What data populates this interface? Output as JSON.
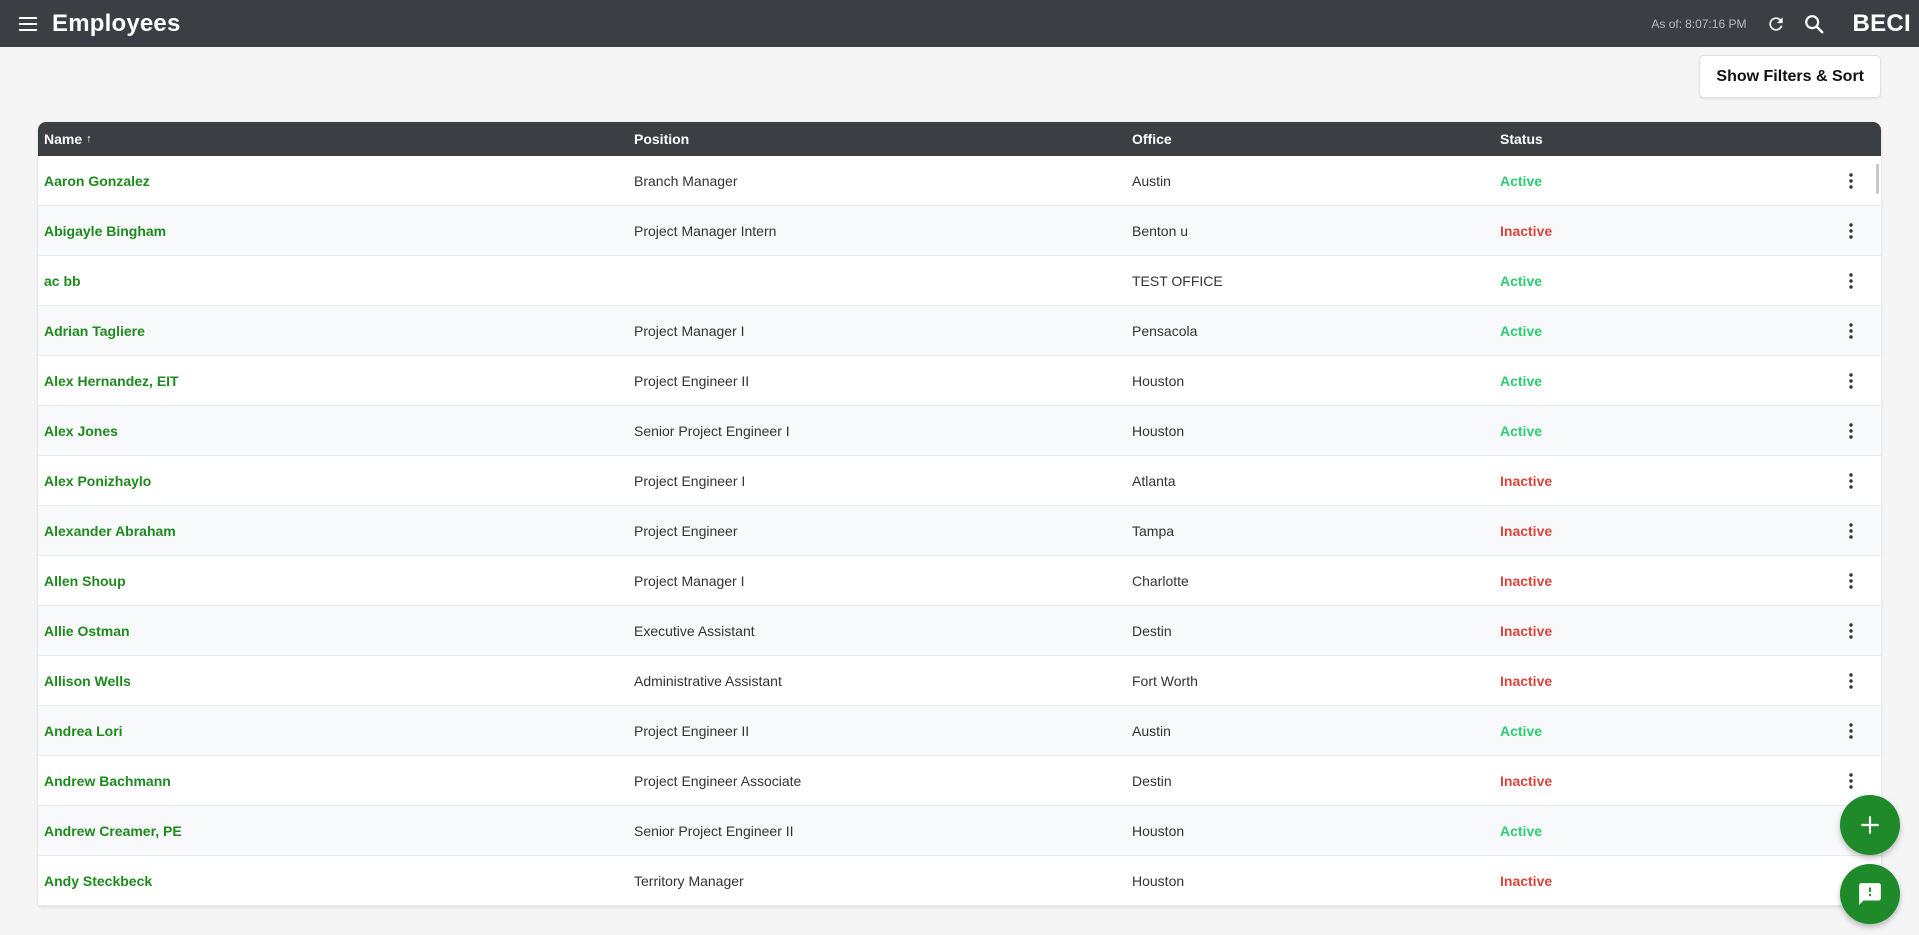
{
  "header": {
    "title": "Employees",
    "as_of_label": "As of:",
    "as_of_time": "8:07:16 PM",
    "brand": "BECI"
  },
  "toolbar": {
    "filter_label": "Show Filters & Sort"
  },
  "table": {
    "columns": {
      "name": "Name",
      "name_sort": "↑",
      "position": "Position",
      "office": "Office",
      "status": "Status"
    },
    "rows": [
      {
        "name": "Aaron Gonzalez",
        "position": "Branch Manager",
        "office": "Austin",
        "status": "Active"
      },
      {
        "name": "Abigayle Bingham",
        "position": "Project Manager Intern",
        "office": "Benton u",
        "status": "Inactive"
      },
      {
        "name": "ac bb",
        "position": "",
        "office": "TEST OFFICE",
        "status": "Active"
      },
      {
        "name": "Adrian Tagliere",
        "position": "Project Manager I",
        "office": "Pensacola",
        "status": "Active"
      },
      {
        "name": "Alex Hernandez, EIT",
        "position": "Project Engineer II",
        "office": "Houston",
        "status": "Active"
      },
      {
        "name": "Alex Jones",
        "position": "Senior Project Engineer I",
        "office": "Houston",
        "status": "Active"
      },
      {
        "name": "Alex Ponizhaylo",
        "position": "Project Engineer I",
        "office": "Atlanta",
        "status": "Inactive"
      },
      {
        "name": "Alexander Abraham",
        "position": "Project Engineer",
        "office": "Tampa",
        "status": "Inactive"
      },
      {
        "name": "Allen Shoup",
        "position": "Project Manager I",
        "office": "Charlotte",
        "status": "Inactive"
      },
      {
        "name": "Allie Ostman",
        "position": "Executive Assistant",
        "office": "Destin",
        "status": "Inactive"
      },
      {
        "name": "Allison Wells",
        "position": "Administrative Assistant",
        "office": "Fort Worth",
        "status": "Inactive"
      },
      {
        "name": "Andrea Lori",
        "position": "Project Engineer II",
        "office": "Austin",
        "status": "Active"
      },
      {
        "name": "Andrew Bachmann",
        "position": "Project Engineer Associate",
        "office": "Destin",
        "status": "Inactive"
      },
      {
        "name": "Andrew Creamer, PE",
        "position": "Senior Project Engineer II",
        "office": "Houston",
        "status": "Active"
      },
      {
        "name": "Andy Steckbeck",
        "position": "Territory Manager",
        "office": "Houston",
        "status": "Inactive"
      }
    ]
  },
  "icons": {
    "menu": "hamburger-menu-icon",
    "refresh": "refresh-icon",
    "search": "search-icon",
    "more": "more-vertical-icon",
    "add": "plus-icon",
    "feedback": "chat-feedback-icon"
  },
  "colors": {
    "header_bg": "#3b3e42",
    "name_link": "#1e8a1e",
    "active": "#2ecc71",
    "inactive": "#d9453a",
    "fab": "#1f8a2a"
  }
}
